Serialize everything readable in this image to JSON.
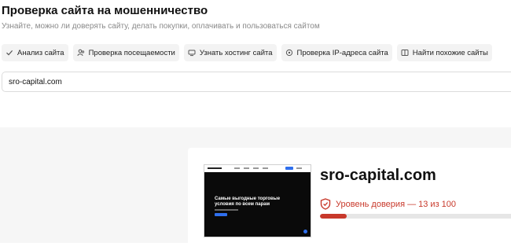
{
  "header": {
    "title": "Проверка сайта на мошенничество",
    "subtitle": "Узнайте, можно ли доверять сайту, делать покупки, оплачивать и пользоваться сайтом"
  },
  "tabs": [
    {
      "label": "Анализ сайта",
      "icon": "check-icon"
    },
    {
      "label": "Проверка посещаемости",
      "icon": "users-icon"
    },
    {
      "label": "Узнать хостинг сайта",
      "icon": "server-icon"
    },
    {
      "label": "Проверка IP-адреса сайта",
      "icon": "location-icon"
    },
    {
      "label": "Найти похожие сайты",
      "icon": "similar-icon"
    }
  ],
  "search": {
    "value": "sro-capital.com"
  },
  "result": {
    "domain": "sro-capital.com",
    "preview_headline": "Самые выгодные торговые условия по всем парам",
    "trust_text": "Уровень доверия — 13 из 100",
    "trust_score": 13,
    "trust_max": 100,
    "trust_color": "#c8392b"
  }
}
